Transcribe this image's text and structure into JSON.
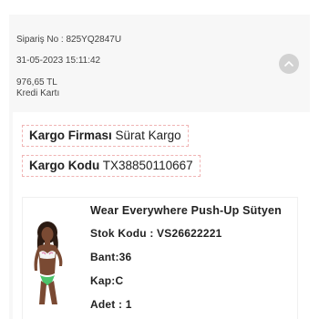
{
  "order": {
    "number": "Sipariş No : 825YQ2847U",
    "date": "31-05-2023 15:11:42",
    "amount": "976,65 TL",
    "payment": "Kredi Kartı"
  },
  "shipment": {
    "company_label": "Kargo Firması",
    "company_value": "Sürat Kargo",
    "code_label": "Kargo Kodu",
    "code_value": "TX38850110667"
  },
  "product": {
    "name": "Wear Everywhere Push-Up Sütyen",
    "sku": "Stok Kodu : VS26622221",
    "band": "Bant:36",
    "cup": "Kap:C",
    "quantity": "Adet : 1"
  },
  "icons": {
    "collapse": "chevron-up-icon"
  },
  "colors": {
    "dashed_border": "#f0b4b4",
    "collapse_button": "#d2d2d2",
    "card_background": "#f7f7f7",
    "swimsuit_green": "#4cc36b"
  }
}
